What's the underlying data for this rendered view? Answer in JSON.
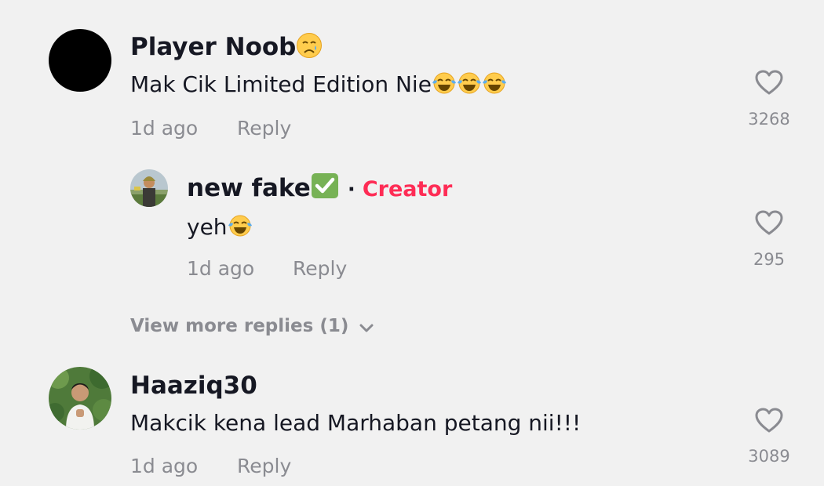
{
  "comments": [
    {
      "username": "Player Noob",
      "username_emoji": "crying-face-emoji",
      "text": "Mak Cik Limited Edition Nie",
      "text_emoji": "tears-of-joy-emoji",
      "time": "1d ago",
      "reply_label": "Reply",
      "likes": "3268",
      "avatar": "black-circle-avatar"
    },
    {
      "username": "Haaziq30",
      "text": "Makcik kena lead Marhaban petang nii!!!",
      "time": "1d ago",
      "reply_label": "Reply",
      "likes": "3089",
      "avatar": "photo-avatar-man-white-shirt"
    }
  ],
  "reply": {
    "username": "new fake",
    "username_emoji": "check-mark-button-emoji",
    "separator": "·",
    "badge": "Creator",
    "text": "yeh",
    "text_emoji": "tears-of-joy-emoji",
    "time": "1d ago",
    "reply_label": "Reply",
    "likes": "295",
    "avatar": "photo-avatar-soldier"
  },
  "view_more": {
    "label": "View more replies (1)",
    "icon": "chevron-down-icon"
  },
  "colors": {
    "background": "#f1f1f1",
    "text": "#161823",
    "secondary": "#8a8b91",
    "creator_badge": "#fe2c55"
  }
}
